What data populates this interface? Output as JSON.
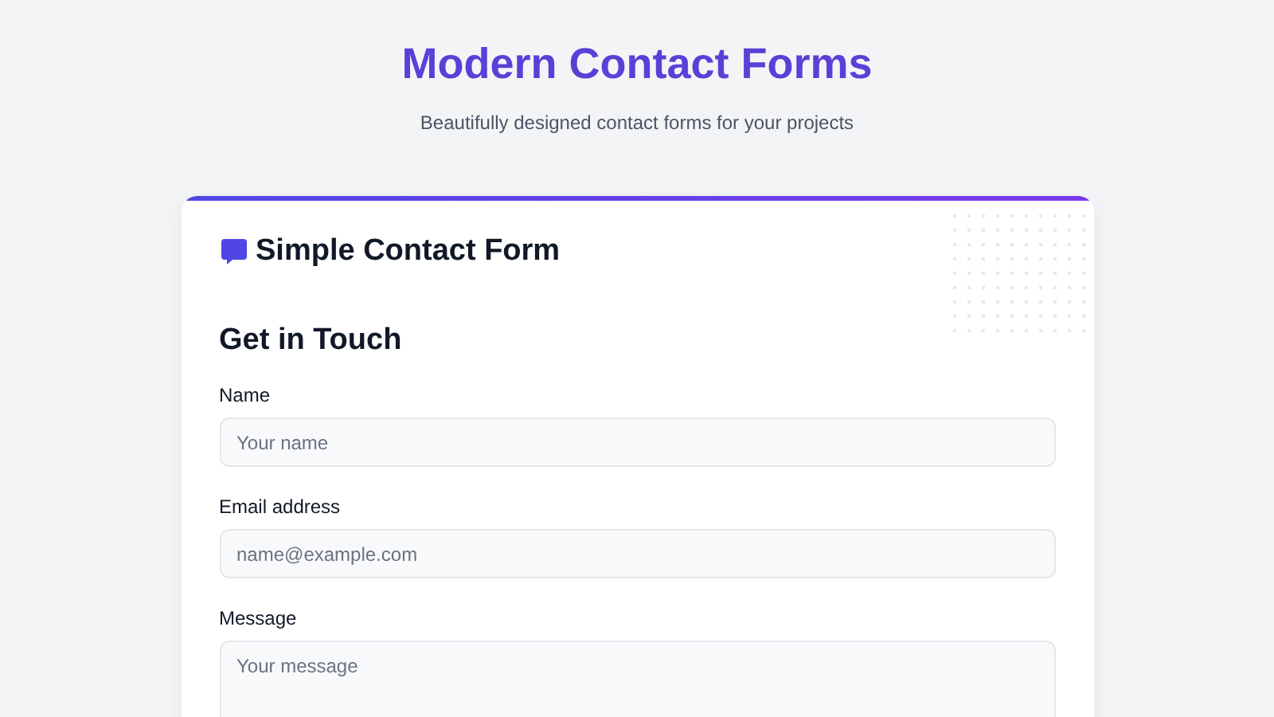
{
  "page": {
    "title": "Modern Contact Forms",
    "subtitle": "Beautifully designed contact forms for your projects"
  },
  "card": {
    "title": "Simple Contact Form",
    "heading": "Get in Touch",
    "fields": [
      {
        "kind": "input",
        "label": "Name",
        "placeholder": "Your name"
      },
      {
        "kind": "input",
        "label": "Email address",
        "placeholder": "name@example.com"
      },
      {
        "kind": "textarea",
        "label": "Message",
        "placeholder": "Your message"
      }
    ]
  }
}
